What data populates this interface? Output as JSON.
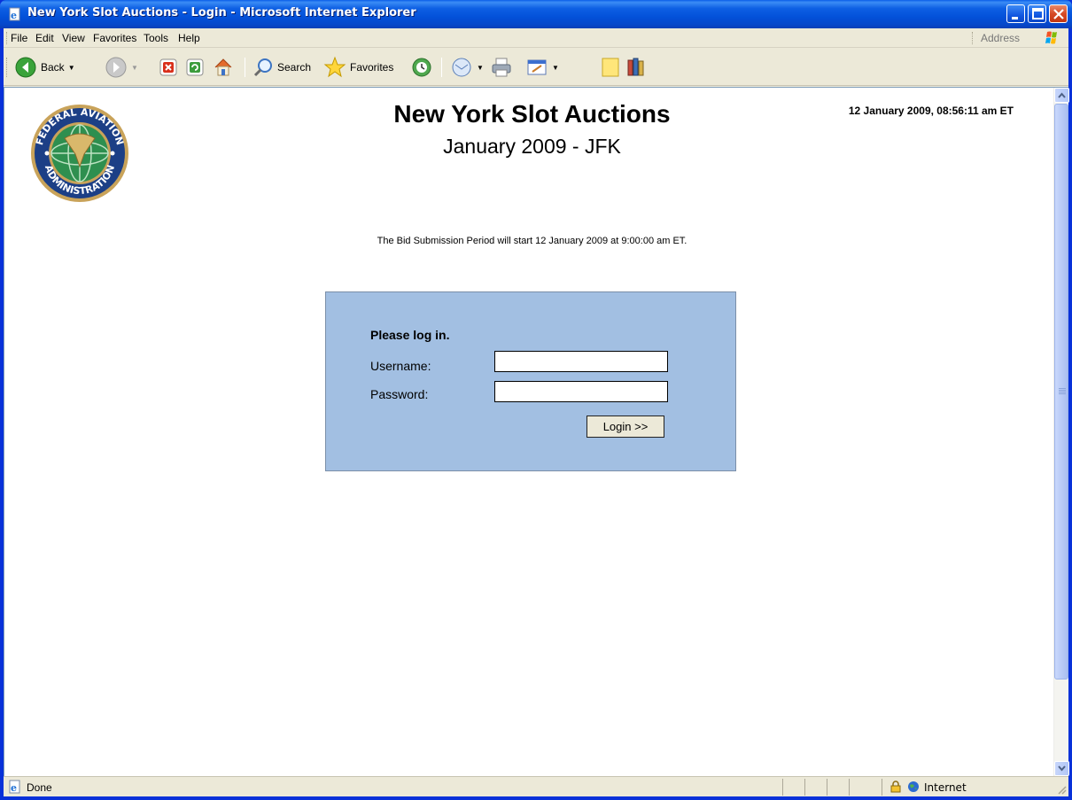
{
  "window": {
    "title": "New York Slot Auctions - Login - Microsoft Internet Explorer"
  },
  "menubar": {
    "items": [
      {
        "label": "File"
      },
      {
        "label": "Edit"
      },
      {
        "label": "View"
      },
      {
        "label": "Favorites"
      },
      {
        "label": "Tools"
      },
      {
        "label": "Help"
      }
    ],
    "address_label": "Address"
  },
  "toolbar": {
    "back_label": "Back",
    "search_label": "Search",
    "favorites_label": "Favorites"
  },
  "page": {
    "title": "New York Slot Auctions",
    "subtitle": "January 2009 - JFK",
    "timestamp": "12 January 2009, 08:56:11 am ET",
    "notice": "The Bid Submission Period will start 12 January 2009 at 9:00:00 am ET.",
    "login": {
      "heading": "Please log in.",
      "username_label": "Username:",
      "password_label": "Password:",
      "username_value": "",
      "password_value": "",
      "button_label": "Login >>"
    },
    "logo": {
      "top_text": "FEDERAL AVIATION",
      "bottom_text": "ADMINISTRATION"
    }
  },
  "statusbar": {
    "status": "Done",
    "zone": "Internet"
  },
  "colors": {
    "titlebar": "#0351d9",
    "login_box": "#a2bfe2",
    "chrome": "#ece9d8"
  }
}
